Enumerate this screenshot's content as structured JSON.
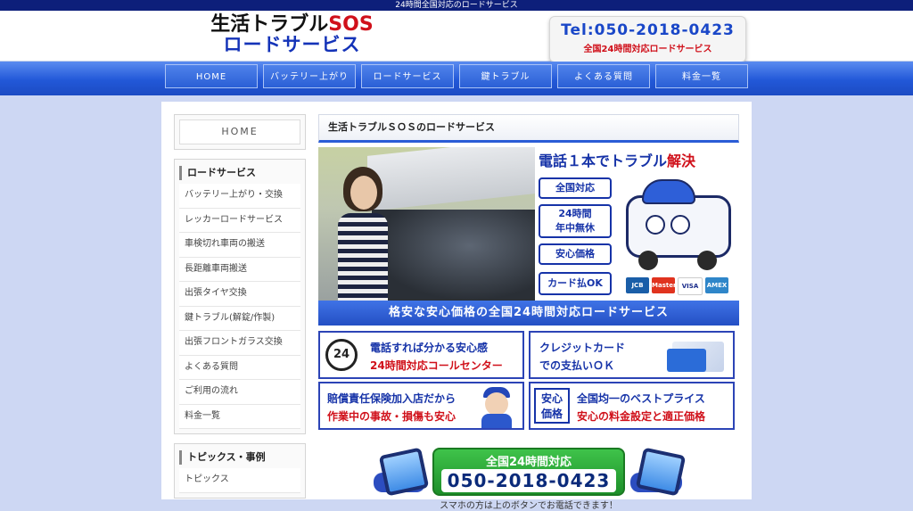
{
  "topbar": {
    "text": "24時間全国対応のロードサービス"
  },
  "header": {
    "logo_line1_a": "生活トラブル",
    "logo_line1_b": "SOS",
    "logo_line2": "ロードサービス",
    "tel": "Tel:050-2018-0423",
    "tel_sub": "全国24時間対応ロードサービス"
  },
  "nav": {
    "items": [
      {
        "label": "HOME"
      },
      {
        "label": "バッテリー上がり"
      },
      {
        "label": "ロードサービス"
      },
      {
        "label": "鍵トラブル"
      },
      {
        "label": "よくある質問"
      },
      {
        "label": "料金一覧"
      }
    ]
  },
  "sidebar": {
    "home_label": "HOME",
    "section1_title": "ロードサービス",
    "items": [
      {
        "label": "バッテリー上がり・交換"
      },
      {
        "label": "レッカーロードサービス"
      },
      {
        "label": "車検切れ車両の搬送"
      },
      {
        "label": "長距離車両搬送"
      },
      {
        "label": "出張タイヤ交換"
      },
      {
        "label": "鍵トラブル(解錠/作製)"
      },
      {
        "label": "出張フロントガラス交換"
      },
      {
        "label": "よくある質問"
      },
      {
        "label": "ご利用の流れ"
      },
      {
        "label": "料金一覧"
      }
    ],
    "section2_title": "トピックス・事例",
    "items2": [
      {
        "label": "トピックス"
      }
    ]
  },
  "main": {
    "title": "生活トラブルＳＯＳのロードサービス",
    "promo_head_a": "電話１本でトラブル",
    "promo_head_b": "解決",
    "badges": [
      "全国対応",
      "24時間",
      "年中無休",
      "安心価格",
      "カード払OK"
    ],
    "cards": [
      "JCB",
      "Master",
      "VISA",
      "AMEX"
    ],
    "banner": "格安な安心価格の全国24時間対応ロードサービス",
    "feat1": {
      "icon": "24",
      "t1": "電話すれば分かる安心感",
      "t2": "24時間対応コールセンター"
    },
    "feat2": {
      "t1": "クレジットカード",
      "t2": "での支払いＯＫ"
    },
    "feat3": {
      "t1": "賠償責任保険加入店だから",
      "t2": "作業中の事故・損傷も安心"
    },
    "feat4": {
      "icon_a": "安心",
      "icon_b": "価格",
      "t1": "全国均一のベストプライス",
      "t2": "安心の料金設定と適正価格"
    },
    "cta_line1": "全国24時間対応",
    "cta_line2": "050-2018-0423",
    "note": "スマホの方は上のボタンでお電話できます！"
  },
  "colors": {
    "accent": "#2258d8",
    "brand_red": "#d0101a",
    "navy": "#0d1f7a"
  }
}
